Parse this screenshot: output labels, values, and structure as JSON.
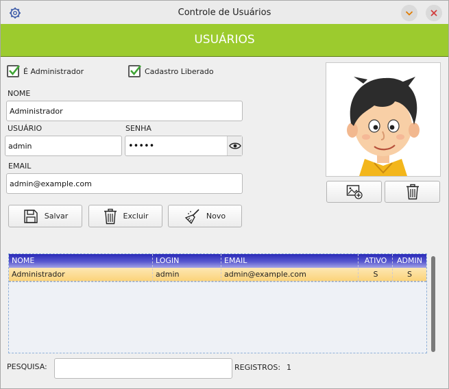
{
  "window": {
    "title": "Controle de Usuários"
  },
  "banner": {
    "title": "USUÁRIOS",
    "color": "#9ccb2e"
  },
  "form": {
    "is_admin_label": "É Administrador",
    "is_admin_checked": true,
    "registration_label": "Cadastro Liberado",
    "registration_checked": true,
    "name_label": "NOME",
    "name_value": "Administrador",
    "user_label": "USUÁRIO",
    "user_value": "admin",
    "password_label": "SENHA",
    "password_value": "•••••",
    "email_label": "EMAIL",
    "email_value": "admin@example.com"
  },
  "actions": {
    "save_label": "Salvar",
    "delete_label": "Excluir",
    "new_label": "Novo"
  },
  "photo": {
    "add_image_icon": "image-add-icon",
    "delete_image_icon": "trash-icon"
  },
  "table": {
    "columns": [
      "NOME",
      "LOGIN",
      "EMAIL",
      "ATIVO",
      "ADMIN"
    ],
    "rows": [
      [
        "Administrador",
        "admin",
        "admin@example.com",
        "S",
        "S"
      ]
    ]
  },
  "footer": {
    "search_label": "PESQUISA:",
    "search_value": "",
    "records_label": "REGISTROS:",
    "records_count": "1"
  }
}
